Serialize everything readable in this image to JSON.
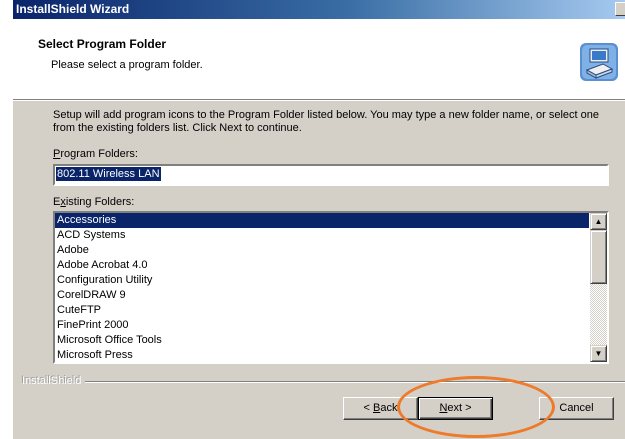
{
  "window": {
    "title": "InstallShield Wizard"
  },
  "header": {
    "title": "Select Program Folder",
    "subtitle": "Please select a program folder."
  },
  "description": "Setup will add program icons to the Program Folder listed below.  You may type a new folder name, or select one from the existing folders list.  Click Next to continue.",
  "program_folders": {
    "label_accel": "P",
    "label_rest": "rogram Folders:",
    "value": "802.11 Wireless LAN"
  },
  "existing_folders": {
    "label_first": "E",
    "label_accel": "x",
    "label_rest": "isting Folders:",
    "items": [
      "Accessories",
      "ACD Systems",
      "Adobe",
      "Adobe Acrobat 4.0",
      "Configuration Utility",
      "CorelDRAW 9",
      "CuteFTP",
      "FinePrint 2000",
      "Microsoft Office Tools",
      "Microsoft Press"
    ],
    "selected_index": 0
  },
  "branding": "InstallShield",
  "buttons": {
    "back_prefix": "< ",
    "back_accel": "B",
    "back_rest": "ack",
    "next_accel": "N",
    "next_rest": "ext >",
    "cancel": "Cancel"
  },
  "colors": {
    "title_start": "#0a246a",
    "title_end": "#a6caf0",
    "selection": "#0a246a",
    "dialog_bg": "#d4d0c8",
    "highlight_ring": "#ee7a2a"
  }
}
